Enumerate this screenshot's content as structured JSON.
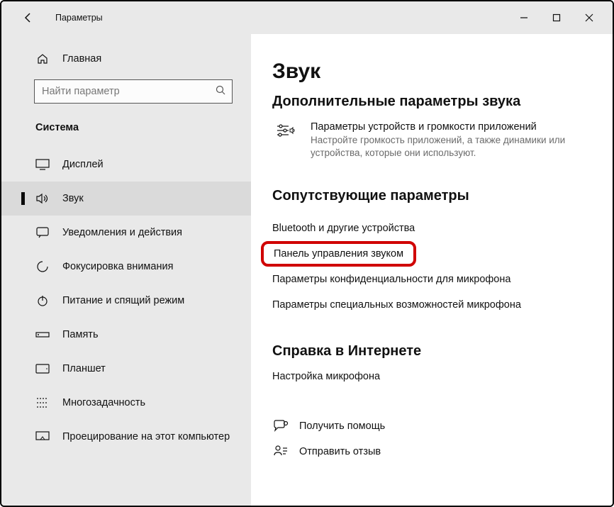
{
  "titlebar": {
    "app_name": "Параметры"
  },
  "sidebar": {
    "home_label": "Главная",
    "search_placeholder": "Найти параметр",
    "category_label": "Система",
    "items": [
      {
        "label": "Дисплей"
      },
      {
        "label": "Звук"
      },
      {
        "label": "Уведомления и действия"
      },
      {
        "label": "Фокусировка внимания"
      },
      {
        "label": "Питание и спящий режим"
      },
      {
        "label": "Память"
      },
      {
        "label": "Планшет"
      },
      {
        "label": "Многозадачность"
      },
      {
        "label": "Проецирование на этот компьютер"
      }
    ]
  },
  "main": {
    "page_title": "Звук",
    "section1_title": "Дополнительные параметры звука",
    "option1": {
      "title": "Параметры устройств и громкости приложений",
      "desc": "Настройте громкость приложений, а также динамики или устройства, которые они используют."
    },
    "section2_title": "Сопутствующие параметры",
    "links": [
      "Bluetooth и другие устройства",
      "Панель управления звуком",
      "Параметры конфиденциальности для микрофона",
      "Параметры специальных возможностей микрофона"
    ],
    "section3_title": "Справка в Интернете",
    "help_link": "Настройка микрофона",
    "footer": {
      "get_help": "Получить помощь",
      "feedback": "Отправить отзыв"
    }
  }
}
